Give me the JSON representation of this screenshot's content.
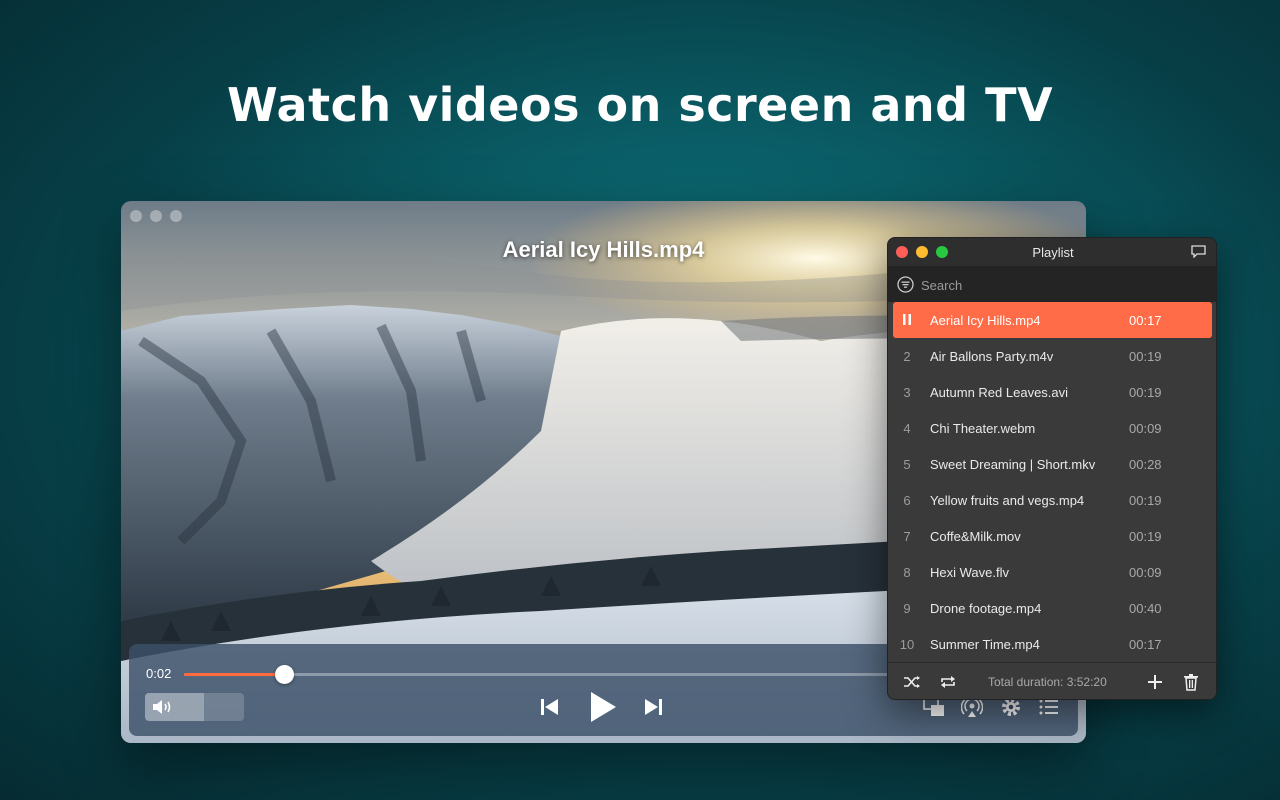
{
  "headline": "Watch videos on screen and TV",
  "player": {
    "video_title": "Aerial Icy Hills.mp4",
    "current_time": "0:02",
    "progress": 0.135,
    "volume": 0.6,
    "accent_color": "#ff6b3d",
    "icons": [
      "volume-icon",
      "previous-icon",
      "play-icon",
      "next-icon",
      "pip-icon",
      "airplay-icon",
      "gear-icon",
      "playlist-icon"
    ]
  },
  "playlist": {
    "title": "Playlist",
    "search_placeholder": "Search",
    "active_color": "#ff6c47",
    "items": [
      {
        "num": "",
        "name": "Aerial Icy Hills.mp4",
        "duration": "00:17",
        "active": true
      },
      {
        "num": "2",
        "name": "Air Ballons Party.m4v",
        "duration": "00:19"
      },
      {
        "num": "3",
        "name": "Autumn Red Leaves.avi",
        "duration": "00:19"
      },
      {
        "num": "4",
        "name": "Chi Theater.webm",
        "duration": "00:09"
      },
      {
        "num": "5",
        "name": "Sweet Dreaming | Short.mkv",
        "duration": "00:28"
      },
      {
        "num": "6",
        "name": "Yellow fruits and vegs.mp4",
        "duration": "00:19"
      },
      {
        "num": "7",
        "name": "Coffe&Milk.mov",
        "duration": "00:19"
      },
      {
        "num": "8",
        "name": "Hexi Wave.flv",
        "duration": "00:09"
      },
      {
        "num": "9",
        "name": "Drone footage.mp4",
        "duration": "00:40"
      },
      {
        "num": "10",
        "name": "Summer Time.mp4",
        "duration": "00:17"
      }
    ],
    "total_duration": "Total duration: 3:52:20"
  }
}
